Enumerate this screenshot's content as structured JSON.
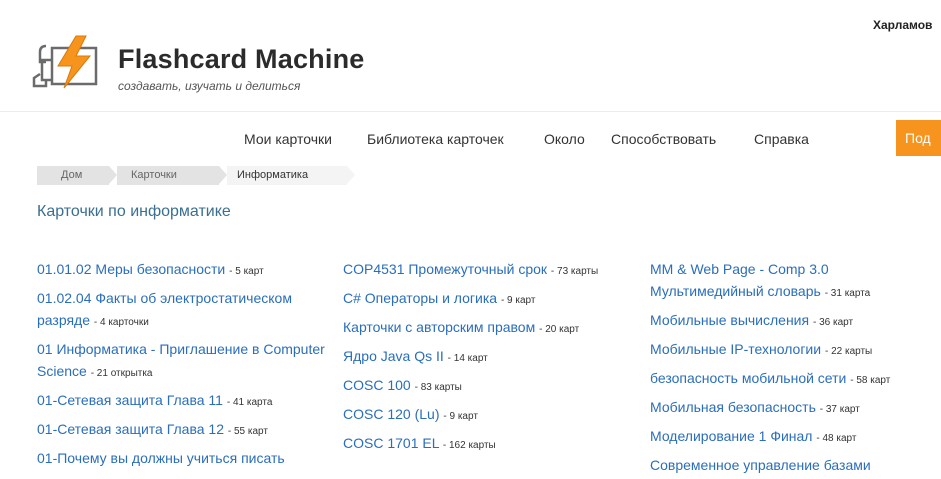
{
  "header": {
    "user_name": "Харламов",
    "app_title": "Flashcard Machine",
    "tagline": "создавать, изучать и делиться"
  },
  "nav": {
    "items": [
      "Мои карточки",
      "Библиотека карточек",
      "Около",
      "Способствовать",
      "Справка"
    ],
    "cta_label": "Под"
  },
  "breadcrumbs": [
    "Дом",
    "Карточки",
    "Информатика"
  ],
  "page": {
    "title": "Карточки по информатике"
  },
  "columns": [
    [
      {
        "title": "01.01.02 Меры безопасности",
        "count": "- 5 карт"
      },
      {
        "title": "01.02.04 Факты об электростатическом разряде",
        "count": "- 4 карточки"
      },
      {
        "title": "01 Информатика - Приглашение в Computer Science",
        "count": "- 21 открытка"
      },
      {
        "title": "01-Сетевая защита Глава 11",
        "count": "- 41 карта"
      },
      {
        "title": "01-Сетевая защита Глава 12",
        "count": "- 55 карт"
      },
      {
        "title": "01-Почему вы должны учиться писать",
        "count": ""
      }
    ],
    [
      {
        "title": "COP4531 Промежуточный срок",
        "count": "- 73 карты"
      },
      {
        "title": "C# Операторы и логика",
        "count": "- 9 карт"
      },
      {
        "title": "Карточки с авторским правом",
        "count": "- 20 карт"
      },
      {
        "title": "Ядро Java Qs II",
        "count": "- 14 карт"
      },
      {
        "title": "COSC 100",
        "count": "- 83 карты"
      },
      {
        "title": "COSC 120 (Lu)",
        "count": "- 9 карт"
      },
      {
        "title": "COSC 1701 EL",
        "count": "- 162 карты"
      }
    ],
    [
      {
        "title": "MM & Web Page - Comp 3.0 Мультимедийный словарь",
        "count": "- 31 карта"
      },
      {
        "title": "Мобильные вычисления",
        "count": "- 36 карт"
      },
      {
        "title": "Мобильные IP-технологии",
        "count": "- 22 карты"
      },
      {
        "title": "безопасность мобильной сети",
        "count": "- 58 карт"
      },
      {
        "title": "Мобильная безопасность",
        "count": "- 37 карт"
      },
      {
        "title": "Моделирование 1 Финал",
        "count": "- 48 карт"
      },
      {
        "title": "Современное управление базами",
        "count": ""
      }
    ]
  ],
  "colors": {
    "link": "#2a6ebb",
    "heading": "#3a6f8f",
    "cta": "#f7941d",
    "bolt": "#f7941d"
  },
  "icons": {
    "logo": "flashcard-bolt-logo-icon"
  }
}
